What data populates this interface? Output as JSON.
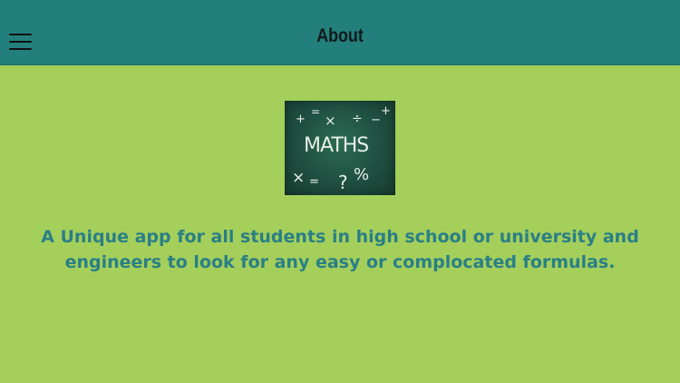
{
  "header": {
    "title": "About",
    "menu_icon": "hamburger-menu-icon"
  },
  "logo": {
    "label": "MATHS",
    "symbols": [
      "+",
      "=",
      "×",
      "÷",
      "−",
      "+",
      "×",
      "=",
      "?",
      "%"
    ]
  },
  "content": {
    "description": "A Unique app for all students in high school or university and engineers to look for any easy or complocated formulas."
  },
  "colors": {
    "header_bg": "#237f7b",
    "page_bg": "#a4cf5a",
    "text_accent": "#2a7f86",
    "chalkboard": "#1f4f40"
  }
}
